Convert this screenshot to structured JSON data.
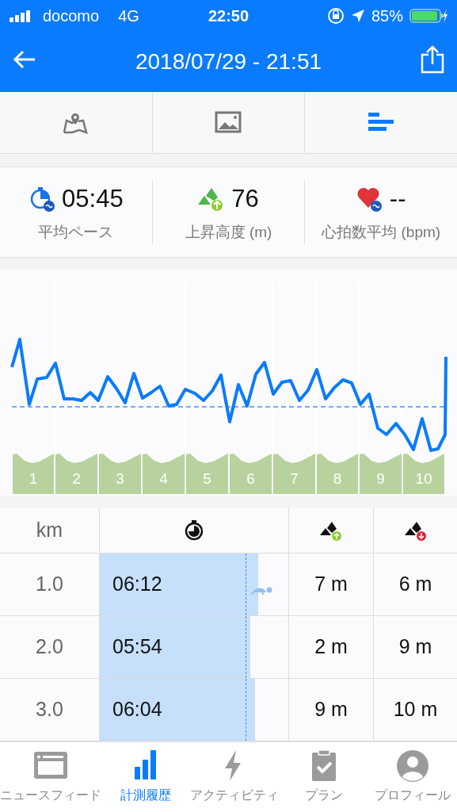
{
  "status_bar": {
    "carrier": "docomo",
    "network": "4G",
    "time": "22:50",
    "battery": "85%"
  },
  "header": {
    "title": "2018/07/29 - 21:51"
  },
  "view_tabs": [
    {
      "kind": "map",
      "selected": false
    },
    {
      "kind": "photo",
      "selected": false
    },
    {
      "kind": "laps",
      "selected": true
    }
  ],
  "stats": [
    {
      "kind": "pace",
      "value": "05:45",
      "label": "平均ペース"
    },
    {
      "kind": "ascent",
      "value": "76",
      "label": "上昇高度 (m)"
    },
    {
      "kind": "heart",
      "value": "--",
      "label": "心拍数平均 (bpm)"
    }
  ],
  "chart": {
    "lap_labels": [
      "1",
      "2",
      "3",
      "4",
      "5",
      "6",
      "7",
      "8",
      "9",
      "10"
    ]
  },
  "table": {
    "columns": [
      {
        "kind": "km",
        "label": "km"
      },
      {
        "kind": "pace"
      },
      {
        "kind": "ascent"
      },
      {
        "kind": "descent"
      }
    ],
    "rows": [
      {
        "km": "1.0",
        "pace": "06:12",
        "level": 0.84,
        "slowest": true,
        "ascent": "7 m",
        "descent": "6 m"
      },
      {
        "km": "2.0",
        "pace": "05:54",
        "level": 0.8,
        "slowest": false,
        "ascent": "2 m",
        "descent": "9 m"
      },
      {
        "km": "3.0",
        "pace": "06:04",
        "level": 0.825,
        "slowest": false,
        "ascent": "9 m",
        "descent": "10 m"
      }
    ]
  },
  "bottom_tabs": [
    {
      "kind": "news",
      "label": "ニュースフィード",
      "selected": false
    },
    {
      "kind": "history",
      "label": "計測履歴",
      "selected": true
    },
    {
      "kind": "activity",
      "label": "アクティビティ",
      "selected": false
    },
    {
      "kind": "plan",
      "label": "プラン",
      "selected": false
    },
    {
      "kind": "profile",
      "label": "プロフィール",
      "selected": false
    }
  ]
}
